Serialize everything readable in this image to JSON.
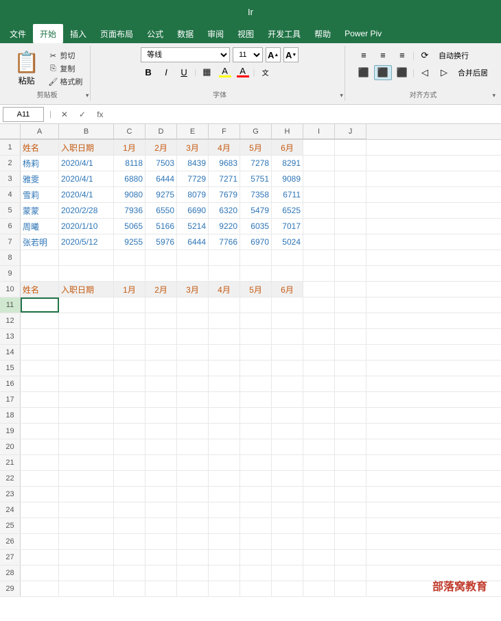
{
  "titlebar": {
    "title": "Ir"
  },
  "menubar": {
    "items": [
      "文件",
      "开始",
      "插入",
      "页面布局",
      "公式",
      "数据",
      "审阅",
      "视图",
      "开发工具",
      "帮助",
      "Power Piv"
    ]
  },
  "ribbon": {
    "clipboard": {
      "label": "剪贴板",
      "paste": "粘贴",
      "cut": "剪切",
      "copy": "复制",
      "format_painter": "格式刷"
    },
    "font": {
      "label": "字体",
      "font_name": "等线",
      "font_size": "11",
      "bold": "B",
      "italic": "I",
      "underline": "U",
      "increase_size": "A",
      "decrease_size": "A",
      "autowrap_label": "自动换行",
      "merge_label": "合并后居"
    },
    "alignment": {
      "label": "对齐方式"
    }
  },
  "formula_bar": {
    "cell_ref": "A11",
    "formula": ""
  },
  "columns": [
    "A",
    "B",
    "C",
    "D",
    "E",
    "F",
    "G",
    "H",
    "I",
    "J"
  ],
  "headers_row1": {
    "A": "姓名",
    "B": "入职日期",
    "C": "1月",
    "D": "2月",
    "E": "3月",
    "F": "4月",
    "G": "5月",
    "H": "6月"
  },
  "data_rows": [
    {
      "name": "杨莉",
      "date": "2020/4/1",
      "m1": "8118",
      "m2": "7503",
      "m3": "8439",
      "m4": "9683",
      "m5": "7278",
      "m6": "8291"
    },
    {
      "name": "雅雯",
      "date": "2020/4/1",
      "m1": "6880",
      "m2": "6444",
      "m3": "7729",
      "m4": "7271",
      "m5": "5751",
      "m6": "9089"
    },
    {
      "name": "雪莉",
      "date": "2020/4/1",
      "m1": "9080",
      "m2": "9275",
      "m3": "8079",
      "m4": "7679",
      "m5": "7358",
      "m6": "6711"
    },
    {
      "name": "蒙蒙",
      "date": "2020/2/28",
      "m1": "7936",
      "m2": "6550",
      "m3": "6690",
      "m4": "6320",
      "m5": "5479",
      "m6": "6525"
    },
    {
      "name": "周曦",
      "date": "2020/1/10",
      "m1": "5065",
      "m2": "5166",
      "m3": "5214",
      "m4": "9220",
      "m5": "6035",
      "m6": "7017"
    },
    {
      "name": "张若明",
      "date": "2020/5/12",
      "m1": "9255",
      "m2": "5976",
      "m3": "6444",
      "m4": "7766",
      "m5": "6970",
      "m6": "5024"
    }
  ],
  "headers_row10": {
    "A": "姓名",
    "B": "入职日期",
    "C": "1月",
    "D": "2月",
    "E": "3月",
    "F": "4月",
    "G": "5月",
    "H": "6月"
  },
  "row_numbers": [
    "1",
    "2",
    "3",
    "4",
    "5",
    "6",
    "7",
    "8",
    "9",
    "10",
    "11",
    "12",
    "13",
    "14",
    "15",
    "16",
    "17",
    "18",
    "19",
    "20",
    "21",
    "22",
    "23",
    "24",
    "25",
    "26",
    "27",
    "28",
    "29"
  ],
  "watermark": "部落窝教育"
}
